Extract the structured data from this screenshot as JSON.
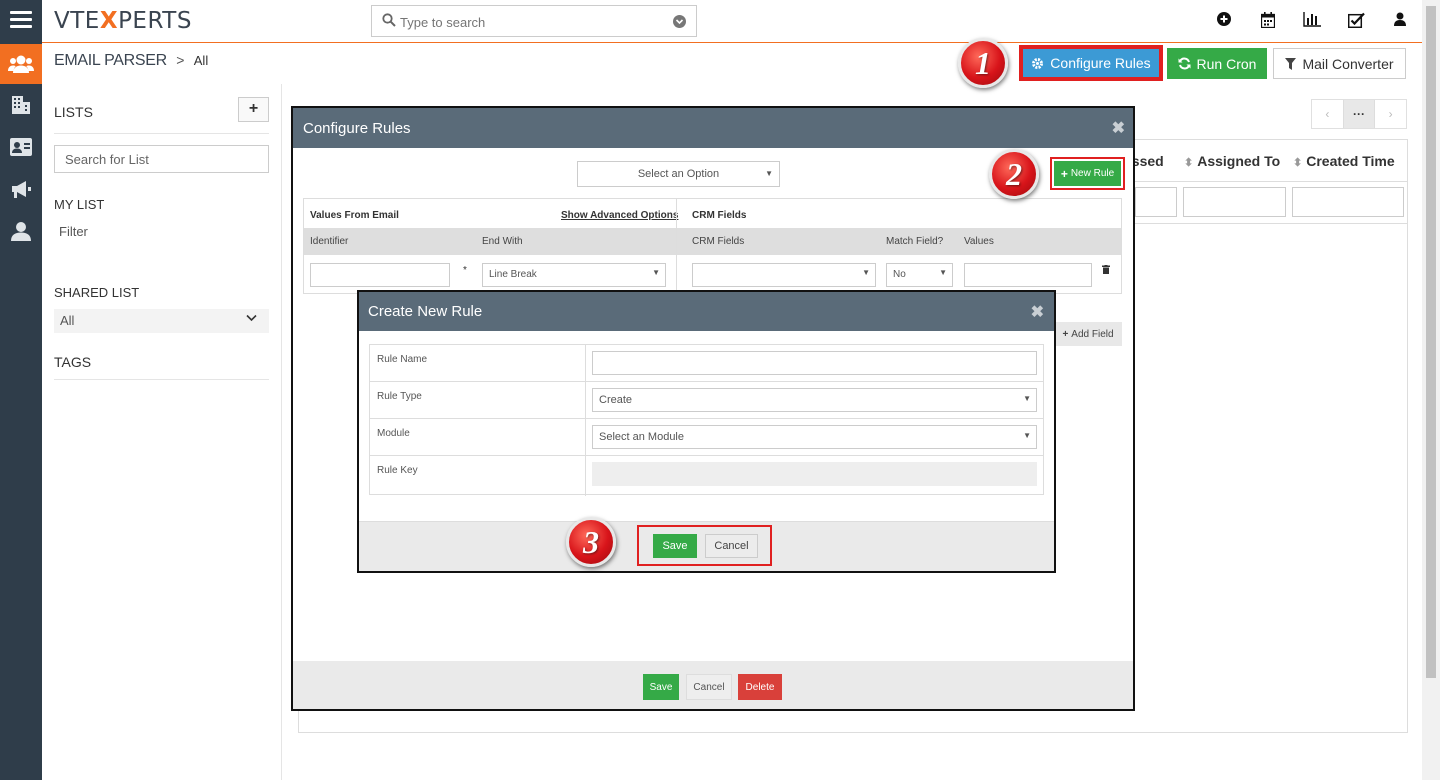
{
  "app": {
    "logo_left": "VTE",
    "logo_mid": "X",
    "logo_right": "PERTS",
    "search_placeholder": "Type to search",
    "accent_color": "#f26f21",
    "top_icons": [
      "plus-circle-icon",
      "calendar-icon",
      "bar-chart-icon",
      "checkbox-icon",
      "user-icon"
    ]
  },
  "breadcrumb": {
    "module": "EMAIL PARSER",
    "separator": ">",
    "current": "All"
  },
  "header_buttons": {
    "configure_rules": "Configure Rules",
    "run_cron": "Run Cron",
    "mail_converter": "Mail Converter"
  },
  "sidebar": {
    "lists_title": "LISTS",
    "add_label": "+",
    "search_list_placeholder": "Search for List",
    "my_list_title": "MY LIST",
    "filter_label": "Filter",
    "shared_list_title": "SHARED LIST",
    "shared_selected": "All",
    "tags_title": "TAGS"
  },
  "list_view": {
    "pager_dots": "···",
    "columns": [
      "essed",
      "Assigned To",
      "Created Time"
    ]
  },
  "configure_modal": {
    "title": "Configure Rules",
    "select_option": "Select an Option",
    "new_rule": "New Rule",
    "values_from_email": "Values From Email",
    "show_advanced": "Show Advanced Options",
    "crm_fields_title": "CRM Fields",
    "headers": [
      "Identifier",
      "End With",
      "CRM Fields",
      "Match Field?",
      "Values"
    ],
    "required_mark": "*",
    "end_with_value": "Line Break",
    "match_value": "No",
    "add_field": "Add Field",
    "save": "Save",
    "cancel": "Cancel",
    "delete": "Delete"
  },
  "create_modal": {
    "title": "Create New Rule",
    "rows": [
      {
        "label": "Rule Name",
        "value": ""
      },
      {
        "label": "Rule Type",
        "value": "Create"
      },
      {
        "label": "Module",
        "value": "Select an Module"
      },
      {
        "label": "Rule Key",
        "value": ""
      }
    ],
    "save": "Save",
    "cancel": "Cancel"
  },
  "steps": [
    "1",
    "2",
    "3"
  ],
  "colors": {
    "green": "#35aa47",
    "blue": "#3c9ad5",
    "red": "#d9403a",
    "highlight": "#e02020",
    "modal_header": "#5a6b79"
  }
}
